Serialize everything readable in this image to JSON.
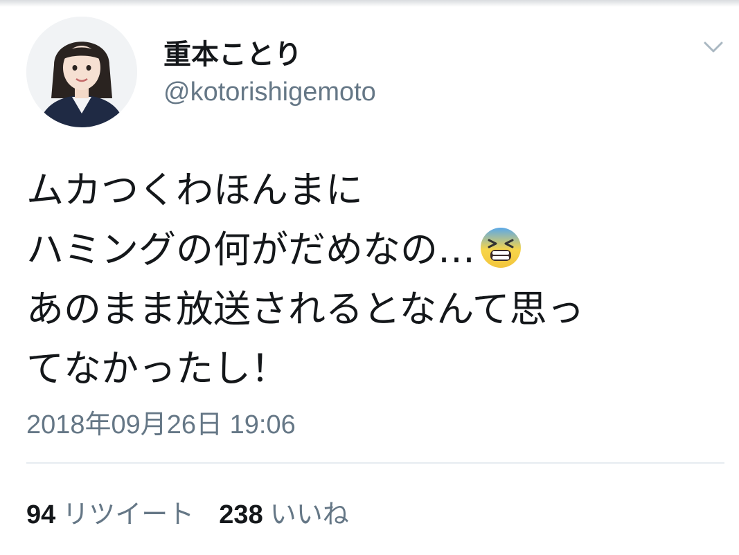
{
  "tweet": {
    "author": {
      "display_name": "重本ことり",
      "handle": "@kotorishigemoto"
    },
    "text_lines": [
      "ムカつくわほんまに",
      "ハミングの何がだめなの…",
      "あのまま放送されるとなんて思っ",
      "てなかったし！"
    ],
    "emoji": "tired-face-emoji",
    "timestamp": "2018年09月26日 19:06",
    "stats": {
      "retweets_count": "94",
      "retweets_label": "リツイート",
      "likes_count": "238",
      "likes_label": "いいね"
    }
  },
  "icons": {
    "menu": "chevron-down-icon"
  },
  "colors": {
    "text_primary": "#14171a",
    "text_secondary": "#657786",
    "divider": "#e6ecf0"
  }
}
